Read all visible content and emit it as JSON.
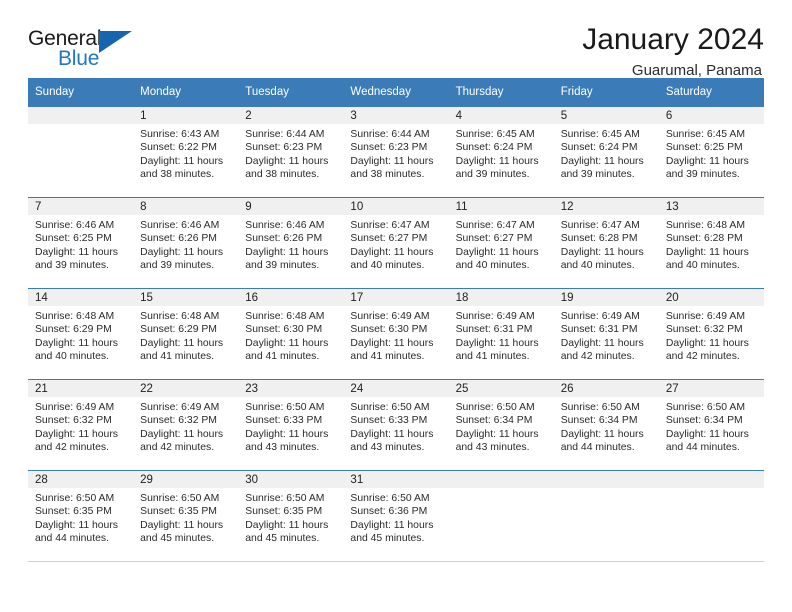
{
  "logo": {
    "word_top": "General",
    "word_bottom": "Blue",
    "triangle_icon": "blue-triangle-icon"
  },
  "header": {
    "title": "January 2024",
    "subtitle": "Guarumal, Panama"
  },
  "colors": {
    "header_blue": "#3b7cb8",
    "logo_blue": "#2079c4",
    "daynum_bg": "#f0f0f0"
  },
  "calendar": {
    "weekdays": [
      "Sunday",
      "Monday",
      "Tuesday",
      "Wednesday",
      "Thursday",
      "Friday",
      "Saturday"
    ],
    "weeks": [
      [
        {
          "day": "",
          "sunrise": "",
          "sunset": "",
          "daylight_line1": "",
          "daylight_line2": ""
        },
        {
          "day": "1",
          "sunrise": "Sunrise: 6:43 AM",
          "sunset": "Sunset: 6:22 PM",
          "daylight_line1": "Daylight: 11 hours",
          "daylight_line2": "and 38 minutes."
        },
        {
          "day": "2",
          "sunrise": "Sunrise: 6:44 AM",
          "sunset": "Sunset: 6:23 PM",
          "daylight_line1": "Daylight: 11 hours",
          "daylight_line2": "and 38 minutes."
        },
        {
          "day": "3",
          "sunrise": "Sunrise: 6:44 AM",
          "sunset": "Sunset: 6:23 PM",
          "daylight_line1": "Daylight: 11 hours",
          "daylight_line2": "and 38 minutes."
        },
        {
          "day": "4",
          "sunrise": "Sunrise: 6:45 AM",
          "sunset": "Sunset: 6:24 PM",
          "daylight_line1": "Daylight: 11 hours",
          "daylight_line2": "and 39 minutes."
        },
        {
          "day": "5",
          "sunrise": "Sunrise: 6:45 AM",
          "sunset": "Sunset: 6:24 PM",
          "daylight_line1": "Daylight: 11 hours",
          "daylight_line2": "and 39 minutes."
        },
        {
          "day": "6",
          "sunrise": "Sunrise: 6:45 AM",
          "sunset": "Sunset: 6:25 PM",
          "daylight_line1": "Daylight: 11 hours",
          "daylight_line2": "and 39 minutes."
        }
      ],
      [
        {
          "day": "7",
          "sunrise": "Sunrise: 6:46 AM",
          "sunset": "Sunset: 6:25 PM",
          "daylight_line1": "Daylight: 11 hours",
          "daylight_line2": "and 39 minutes."
        },
        {
          "day": "8",
          "sunrise": "Sunrise: 6:46 AM",
          "sunset": "Sunset: 6:26 PM",
          "daylight_line1": "Daylight: 11 hours",
          "daylight_line2": "and 39 minutes."
        },
        {
          "day": "9",
          "sunrise": "Sunrise: 6:46 AM",
          "sunset": "Sunset: 6:26 PM",
          "daylight_line1": "Daylight: 11 hours",
          "daylight_line2": "and 39 minutes."
        },
        {
          "day": "10",
          "sunrise": "Sunrise: 6:47 AM",
          "sunset": "Sunset: 6:27 PM",
          "daylight_line1": "Daylight: 11 hours",
          "daylight_line2": "and 40 minutes."
        },
        {
          "day": "11",
          "sunrise": "Sunrise: 6:47 AM",
          "sunset": "Sunset: 6:27 PM",
          "daylight_line1": "Daylight: 11 hours",
          "daylight_line2": "and 40 minutes."
        },
        {
          "day": "12",
          "sunrise": "Sunrise: 6:47 AM",
          "sunset": "Sunset: 6:28 PM",
          "daylight_line1": "Daylight: 11 hours",
          "daylight_line2": "and 40 minutes."
        },
        {
          "day": "13",
          "sunrise": "Sunrise: 6:48 AM",
          "sunset": "Sunset: 6:28 PM",
          "daylight_line1": "Daylight: 11 hours",
          "daylight_line2": "and 40 minutes."
        }
      ],
      [
        {
          "day": "14",
          "sunrise": "Sunrise: 6:48 AM",
          "sunset": "Sunset: 6:29 PM",
          "daylight_line1": "Daylight: 11 hours",
          "daylight_line2": "and 40 minutes."
        },
        {
          "day": "15",
          "sunrise": "Sunrise: 6:48 AM",
          "sunset": "Sunset: 6:29 PM",
          "daylight_line1": "Daylight: 11 hours",
          "daylight_line2": "and 41 minutes."
        },
        {
          "day": "16",
          "sunrise": "Sunrise: 6:48 AM",
          "sunset": "Sunset: 6:30 PM",
          "daylight_line1": "Daylight: 11 hours",
          "daylight_line2": "and 41 minutes."
        },
        {
          "day": "17",
          "sunrise": "Sunrise: 6:49 AM",
          "sunset": "Sunset: 6:30 PM",
          "daylight_line1": "Daylight: 11 hours",
          "daylight_line2": "and 41 minutes."
        },
        {
          "day": "18",
          "sunrise": "Sunrise: 6:49 AM",
          "sunset": "Sunset: 6:31 PM",
          "daylight_line1": "Daylight: 11 hours",
          "daylight_line2": "and 41 minutes."
        },
        {
          "day": "19",
          "sunrise": "Sunrise: 6:49 AM",
          "sunset": "Sunset: 6:31 PM",
          "daylight_line1": "Daylight: 11 hours",
          "daylight_line2": "and 42 minutes."
        },
        {
          "day": "20",
          "sunrise": "Sunrise: 6:49 AM",
          "sunset": "Sunset: 6:32 PM",
          "daylight_line1": "Daylight: 11 hours",
          "daylight_line2": "and 42 minutes."
        }
      ],
      [
        {
          "day": "21",
          "sunrise": "Sunrise: 6:49 AM",
          "sunset": "Sunset: 6:32 PM",
          "daylight_line1": "Daylight: 11 hours",
          "daylight_line2": "and 42 minutes."
        },
        {
          "day": "22",
          "sunrise": "Sunrise: 6:49 AM",
          "sunset": "Sunset: 6:32 PM",
          "daylight_line1": "Daylight: 11 hours",
          "daylight_line2": "and 42 minutes."
        },
        {
          "day": "23",
          "sunrise": "Sunrise: 6:50 AM",
          "sunset": "Sunset: 6:33 PM",
          "daylight_line1": "Daylight: 11 hours",
          "daylight_line2": "and 43 minutes."
        },
        {
          "day": "24",
          "sunrise": "Sunrise: 6:50 AM",
          "sunset": "Sunset: 6:33 PM",
          "daylight_line1": "Daylight: 11 hours",
          "daylight_line2": "and 43 minutes."
        },
        {
          "day": "25",
          "sunrise": "Sunrise: 6:50 AM",
          "sunset": "Sunset: 6:34 PM",
          "daylight_line1": "Daylight: 11 hours",
          "daylight_line2": "and 43 minutes."
        },
        {
          "day": "26",
          "sunrise": "Sunrise: 6:50 AM",
          "sunset": "Sunset: 6:34 PM",
          "daylight_line1": "Daylight: 11 hours",
          "daylight_line2": "and 44 minutes."
        },
        {
          "day": "27",
          "sunrise": "Sunrise: 6:50 AM",
          "sunset": "Sunset: 6:34 PM",
          "daylight_line1": "Daylight: 11 hours",
          "daylight_line2": "and 44 minutes."
        }
      ],
      [
        {
          "day": "28",
          "sunrise": "Sunrise: 6:50 AM",
          "sunset": "Sunset: 6:35 PM",
          "daylight_line1": "Daylight: 11 hours",
          "daylight_line2": "and 44 minutes."
        },
        {
          "day": "29",
          "sunrise": "Sunrise: 6:50 AM",
          "sunset": "Sunset: 6:35 PM",
          "daylight_line1": "Daylight: 11 hours",
          "daylight_line2": "and 45 minutes."
        },
        {
          "day": "30",
          "sunrise": "Sunrise: 6:50 AM",
          "sunset": "Sunset: 6:35 PM",
          "daylight_line1": "Daylight: 11 hours",
          "daylight_line2": "and 45 minutes."
        },
        {
          "day": "31",
          "sunrise": "Sunrise: 6:50 AM",
          "sunset": "Sunset: 6:36 PM",
          "daylight_line1": "Daylight: 11 hours",
          "daylight_line2": "and 45 minutes."
        },
        {
          "day": "",
          "sunrise": "",
          "sunset": "",
          "daylight_line1": "",
          "daylight_line2": ""
        },
        {
          "day": "",
          "sunrise": "",
          "sunset": "",
          "daylight_line1": "",
          "daylight_line2": ""
        },
        {
          "day": "",
          "sunrise": "",
          "sunset": "",
          "daylight_line1": "",
          "daylight_line2": ""
        }
      ]
    ]
  }
}
